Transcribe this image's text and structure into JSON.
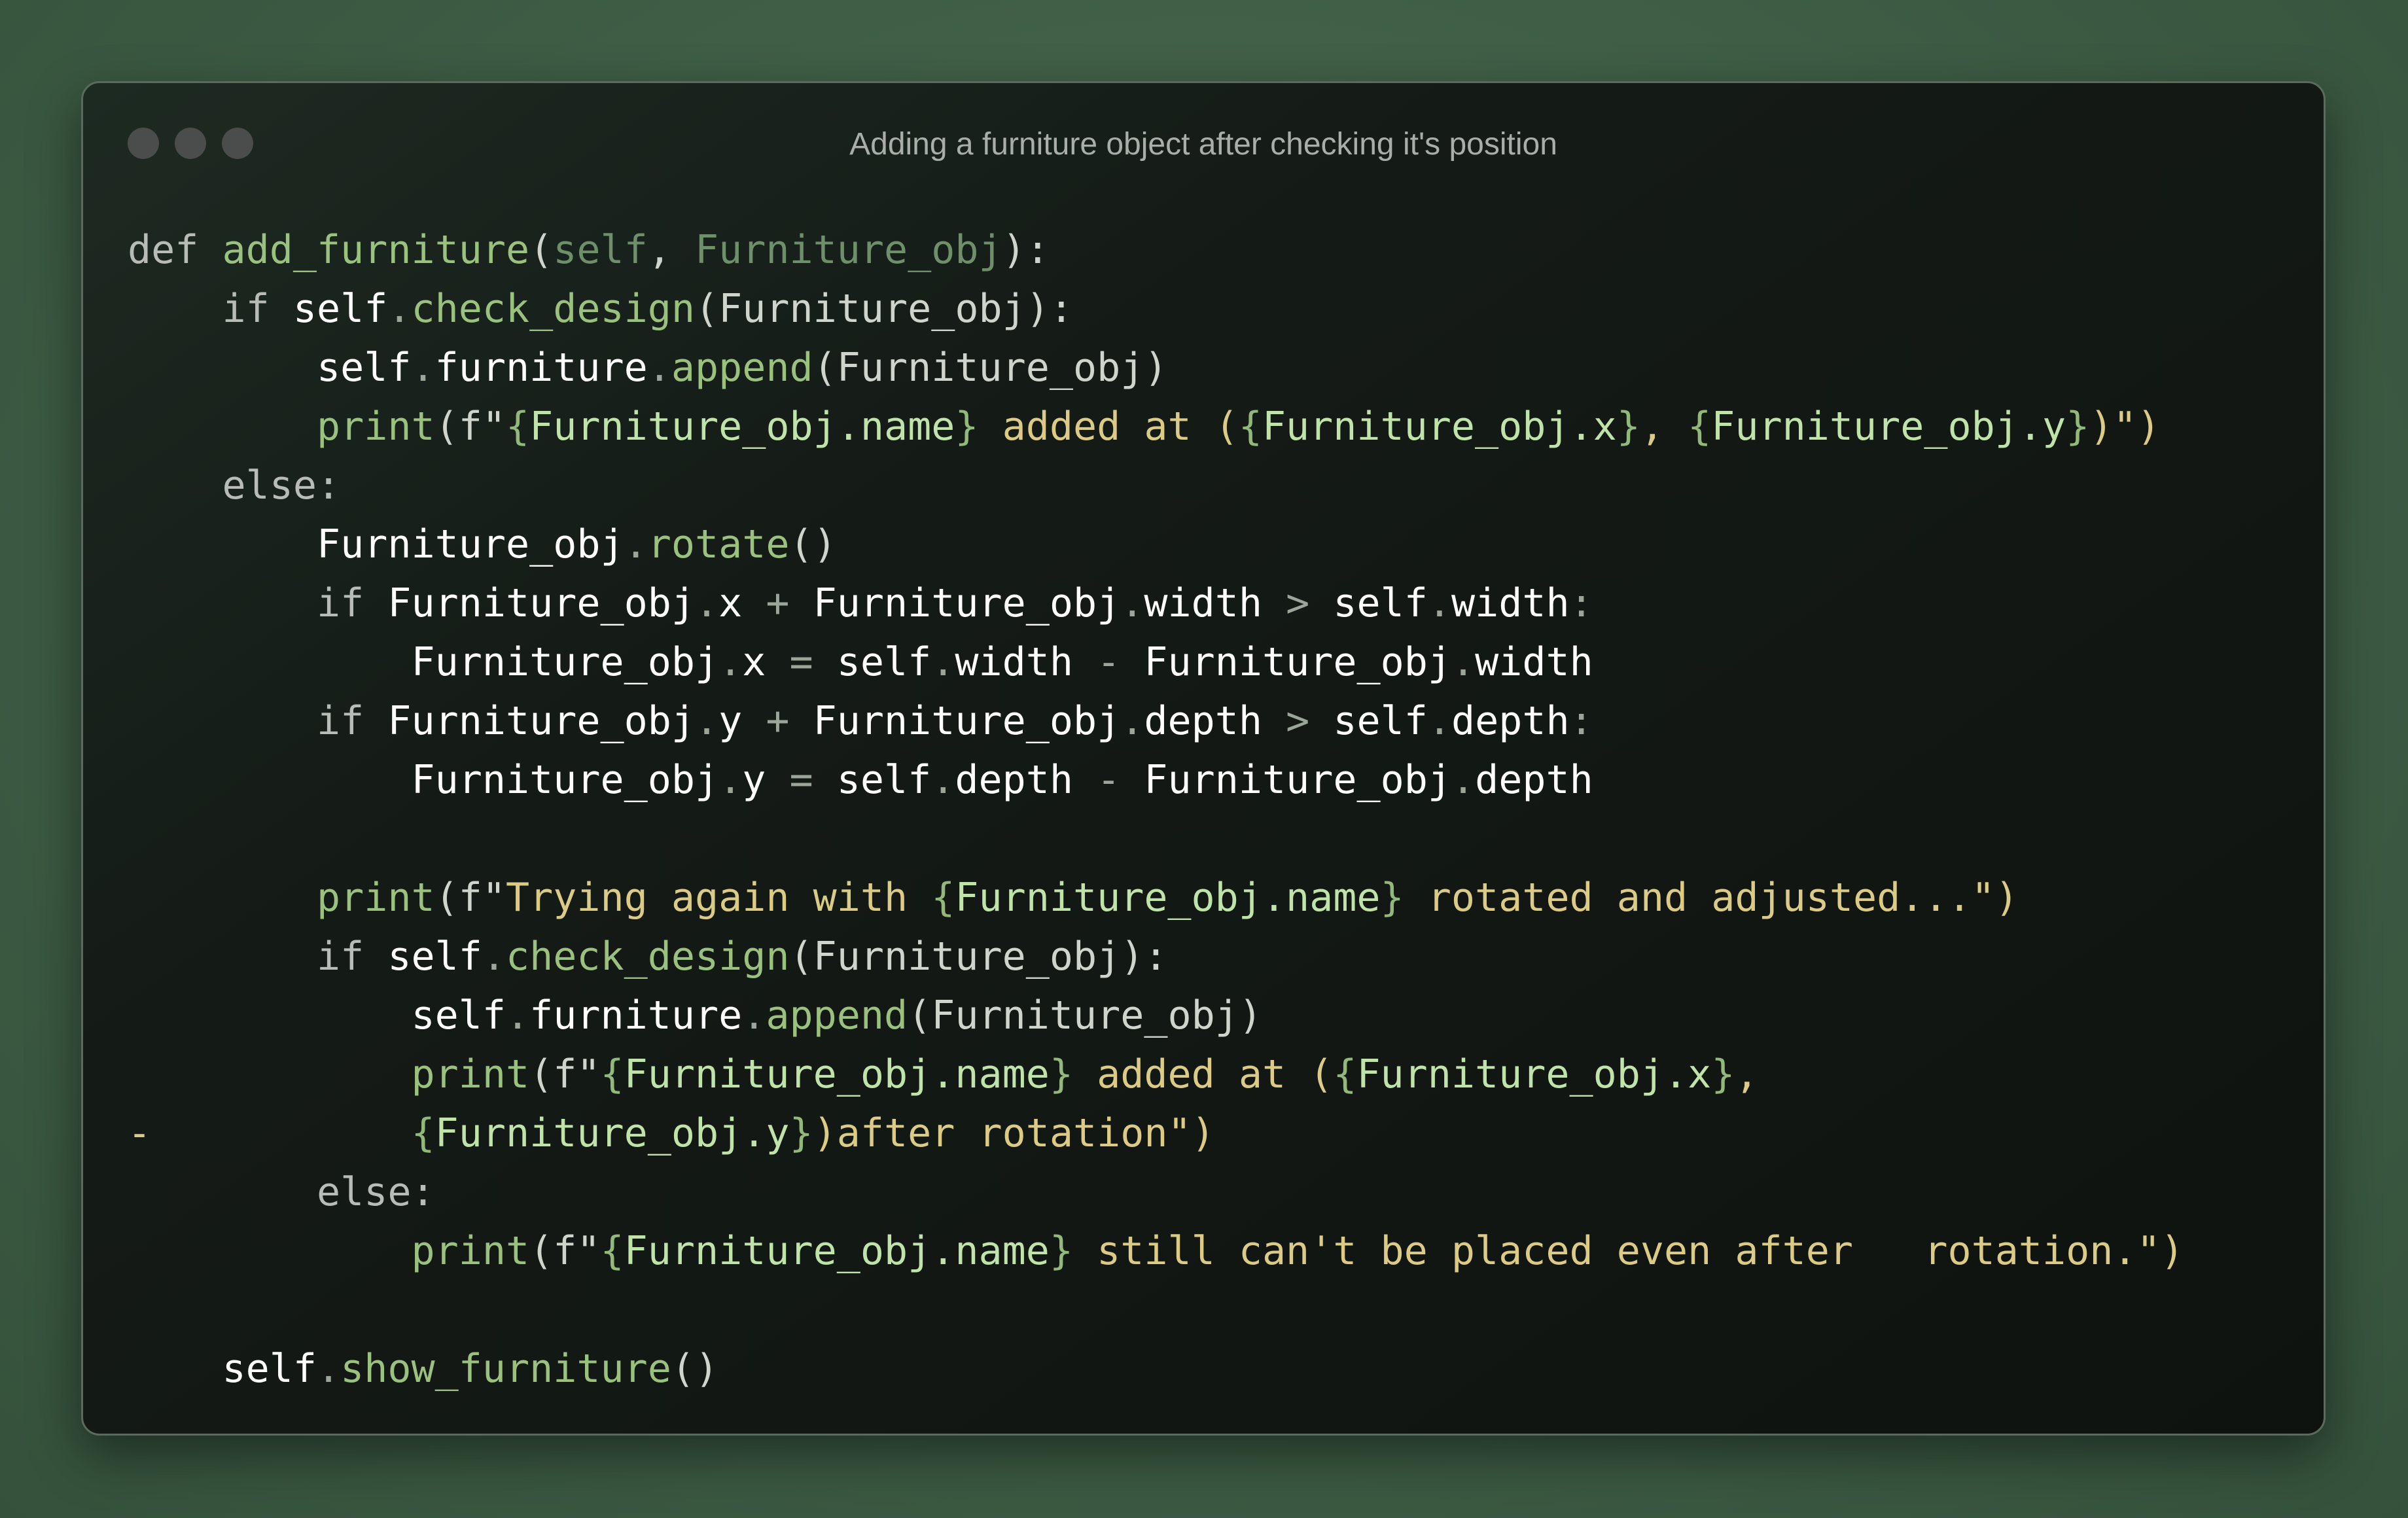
{
  "window": {
    "title": "Adding a furniture object after checking it's position",
    "controls": [
      "close",
      "minimize",
      "maximize"
    ]
  },
  "code": {
    "language": "python",
    "lines": [
      [
        [
          "kw",
          "def "
        ],
        [
          "fn",
          "add_furniture"
        ],
        [
          "pl",
          "("
        ],
        [
          "sf",
          "self"
        ],
        [
          "pl",
          ", "
        ],
        [
          "sf",
          "Furniture_obj"
        ],
        [
          "pl",
          "):"
        ]
      ],
      [
        [
          "pl",
          "    "
        ],
        [
          "kw",
          "if "
        ],
        [
          "id",
          "self"
        ],
        [
          "op",
          "."
        ],
        [
          "fn",
          "check_design"
        ],
        [
          "pl",
          "(Furniture_obj):"
        ]
      ],
      [
        [
          "pl",
          "        "
        ],
        [
          "id",
          "self"
        ],
        [
          "op",
          "."
        ],
        [
          "id",
          "furniture"
        ],
        [
          "op",
          "."
        ],
        [
          "fn",
          "append"
        ],
        [
          "pl",
          "(Furniture_obj)"
        ]
      ],
      [
        [
          "pl",
          "        "
        ],
        [
          "fn",
          "print"
        ],
        [
          "pl",
          "(f\""
        ],
        [
          "br",
          "{"
        ],
        [
          "ex",
          "Furniture_obj.name"
        ],
        [
          "br",
          "}"
        ],
        [
          "st",
          " added at ("
        ],
        [
          "br",
          "{"
        ],
        [
          "ex",
          "Furniture_obj.x"
        ],
        [
          "br",
          "}"
        ],
        [
          "st",
          ", "
        ],
        [
          "br",
          "{"
        ],
        [
          "ex",
          "Furniture_obj.y"
        ],
        [
          "br",
          "}"
        ],
        [
          "st",
          ")\")"
        ]
      ],
      [
        [
          "pl",
          "    "
        ],
        [
          "kw",
          "else:"
        ]
      ],
      [
        [
          "pl",
          "        "
        ],
        [
          "id",
          "Furniture_obj"
        ],
        [
          "op",
          "."
        ],
        [
          "fn",
          "rotate"
        ],
        [
          "pl",
          "()"
        ]
      ],
      [
        [
          "pl",
          "        "
        ],
        [
          "kw",
          "if "
        ],
        [
          "id",
          "Furniture_obj"
        ],
        [
          "op",
          "."
        ],
        [
          "id",
          "x"
        ],
        [
          "op",
          " + "
        ],
        [
          "id",
          "Furniture_obj"
        ],
        [
          "op",
          "."
        ],
        [
          "id",
          "width"
        ],
        [
          "op",
          " > "
        ],
        [
          "id",
          "self"
        ],
        [
          "op",
          "."
        ],
        [
          "id",
          "width"
        ],
        [
          "op",
          ":"
        ]
      ],
      [
        [
          "pl",
          "            "
        ],
        [
          "id",
          "Furniture_obj"
        ],
        [
          "op",
          "."
        ],
        [
          "id",
          "x"
        ],
        [
          "op",
          " = "
        ],
        [
          "id",
          "self"
        ],
        [
          "op",
          "."
        ],
        [
          "id",
          "width"
        ],
        [
          "op",
          " - "
        ],
        [
          "id",
          "Furniture_obj"
        ],
        [
          "op",
          "."
        ],
        [
          "id",
          "width"
        ]
      ],
      [
        [
          "pl",
          "        "
        ],
        [
          "kw",
          "if "
        ],
        [
          "id",
          "Furniture_obj"
        ],
        [
          "op",
          "."
        ],
        [
          "id",
          "y"
        ],
        [
          "op",
          " + "
        ],
        [
          "id",
          "Furniture_obj"
        ],
        [
          "op",
          "."
        ],
        [
          "id",
          "depth"
        ],
        [
          "op",
          " > "
        ],
        [
          "id",
          "self"
        ],
        [
          "op",
          "."
        ],
        [
          "id",
          "depth"
        ],
        [
          "op",
          ":"
        ]
      ],
      [
        [
          "pl",
          "            "
        ],
        [
          "id",
          "Furniture_obj"
        ],
        [
          "op",
          "."
        ],
        [
          "id",
          "y"
        ],
        [
          "op",
          " = "
        ],
        [
          "id",
          "self"
        ],
        [
          "op",
          "."
        ],
        [
          "id",
          "depth"
        ],
        [
          "op",
          " - "
        ],
        [
          "id",
          "Furniture_obj"
        ],
        [
          "op",
          "."
        ],
        [
          "id",
          "depth"
        ]
      ],
      [],
      [
        [
          "pl",
          "        "
        ],
        [
          "fn",
          "print"
        ],
        [
          "pl",
          "(f\""
        ],
        [
          "st",
          "Trying again with "
        ],
        [
          "br",
          "{"
        ],
        [
          "ex",
          "Furniture_obj.name"
        ],
        [
          "br",
          "}"
        ],
        [
          "st",
          " rotated and adjusted...\")"
        ]
      ],
      [
        [
          "pl",
          "        "
        ],
        [
          "kw",
          "if "
        ],
        [
          "id",
          "self"
        ],
        [
          "op",
          "."
        ],
        [
          "fn",
          "check_design"
        ],
        [
          "pl",
          "(Furniture_obj):"
        ]
      ],
      [
        [
          "pl",
          "            "
        ],
        [
          "id",
          "self"
        ],
        [
          "op",
          "."
        ],
        [
          "id",
          "furniture"
        ],
        [
          "op",
          "."
        ],
        [
          "fn",
          "append"
        ],
        [
          "pl",
          "(Furniture_obj)"
        ]
      ],
      [
        [
          "pl",
          "            "
        ],
        [
          "fn",
          "print"
        ],
        [
          "pl",
          "(f\""
        ],
        [
          "br",
          "{"
        ],
        [
          "ex",
          "Furniture_obj.name"
        ],
        [
          "br",
          "}"
        ],
        [
          "st",
          " added at ("
        ],
        [
          "br",
          "{"
        ],
        [
          "ex",
          "Furniture_obj.x"
        ],
        [
          "br",
          "}"
        ],
        [
          "st",
          ","
        ]
      ],
      [
        [
          "mk",
          "-"
        ],
        [
          "pl",
          "           "
        ],
        [
          "br",
          "{"
        ],
        [
          "ex",
          "Furniture_obj.y"
        ],
        [
          "br",
          "}"
        ],
        [
          "st",
          ")after rotation\")"
        ]
      ],
      [
        [
          "pl",
          "        "
        ],
        [
          "kw",
          "else:"
        ]
      ],
      [
        [
          "pl",
          "            "
        ],
        [
          "fn",
          "print"
        ],
        [
          "pl",
          "(f\""
        ],
        [
          "br",
          "{"
        ],
        [
          "ex",
          "Furniture_obj.name"
        ],
        [
          "br",
          "}"
        ],
        [
          "st",
          " still can't be placed even after   rotation.\")"
        ]
      ],
      [],
      [
        [
          "pl",
          "    "
        ],
        [
          "id",
          "self"
        ],
        [
          "op",
          "."
        ],
        [
          "fn",
          "show_furniture"
        ],
        [
          "pl",
          "()"
        ]
      ]
    ]
  }
}
